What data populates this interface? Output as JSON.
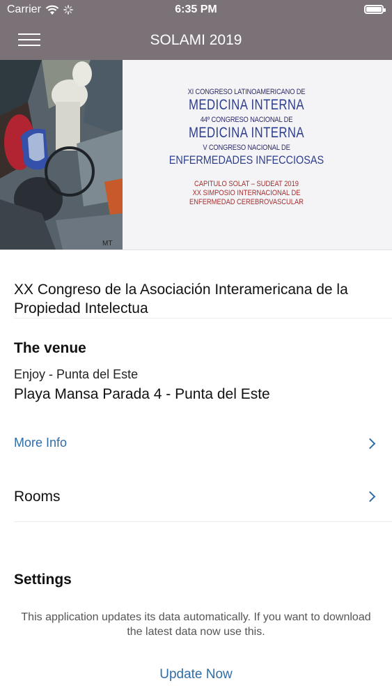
{
  "status_bar": {
    "carrier": "Carrier",
    "time": "6:35 PM",
    "battery_level": 1.0
  },
  "navbar": {
    "title": "SOLAMI 2019",
    "menu_icon": "hamburger-menu-icon"
  },
  "banner": {
    "line1": "XI CONGRESO LATINOAMERICANO DE",
    "line2": "MEDICINA INTERNA",
    "line3": "44º CONGRESO NACIONAL DE",
    "line4": "MEDICINA INTERNA",
    "line5": "V CONGRESO NACIONAL DE",
    "line6": "ENFERMEDADES INFECCIOSAS",
    "line7": "CAPITULO SOLAT – SUDEAT 2019",
    "line8": "XX SIMPOSIO INTERNACIONAL DE",
    "line9": "ENFERMEDAD CEREBROVASCULAR",
    "painting_signature": "MT"
  },
  "event": {
    "title": "XX Congreso de la Asociación Interamericana de la Propiedad Intelectua"
  },
  "venue": {
    "heading": "The venue",
    "name": "Enjoy - Punta del Este",
    "address": "Playa Mansa Parada 4 - Punta del Este",
    "more_info_label": "More Info",
    "rooms_label": "Rooms"
  },
  "settings": {
    "heading": "Settings",
    "description": "This application updates its data automatically. If you want to download the latest data now use this.",
    "update_label": "Update Now"
  },
  "colors": {
    "navbar": "#7b7277",
    "link": "#2f6da6",
    "banner_blue": "#2d3e8f",
    "banner_red": "#a33030"
  }
}
